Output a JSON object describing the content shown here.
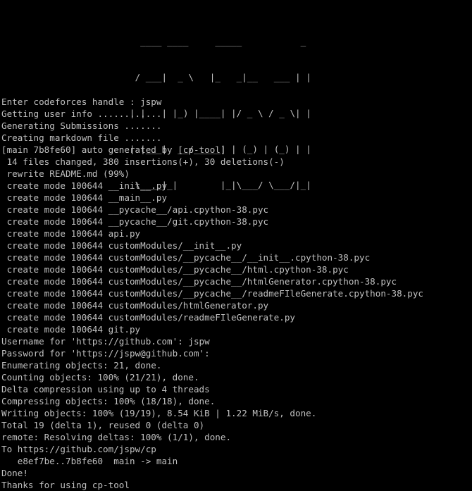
{
  "colors": {
    "background": "#000000",
    "text": "#c0c0c0"
  },
  "banner": [
    "  ____ ____     _____           _ ",
    " / ___|  _ \\   |_   _|__   ___ | |",
    "| |   | |_) |____| |/ _ \\ / _ \\| |",
    "| |___|  __/_____| | (_) | (_) | |",
    " \\____|_|        |_|\\___/ \\___/|_|"
  ],
  "lines": [
    "Enter codeforces handle : jspw",
    "Getting user info ............",
    "Generating Submissions .......",
    "Creating markdown file .......",
    "[main 7b8fe60] auto generated by [cp-tool]",
    " 14 files changed, 380 insertions(+), 30 deletions(-)",
    " rewrite README.md (99%)",
    " create mode 100644 __init__.py",
    " create mode 100644 __main__.py",
    " create mode 100644 __pycache__/api.cpython-38.pyc",
    " create mode 100644 __pycache__/git.cpython-38.pyc",
    " create mode 100644 api.py",
    " create mode 100644 customModules/__init__.py",
    " create mode 100644 customModules/__pycache__/__init__.cpython-38.pyc",
    " create mode 100644 customModules/__pycache__/html.cpython-38.pyc",
    " create mode 100644 customModules/__pycache__/htmlGenerator.cpython-38.pyc",
    " create mode 100644 customModules/__pycache__/readmeFIleGenerate.cpython-38.pyc",
    " create mode 100644 customModules/htmlGenerator.py",
    " create mode 100644 customModules/readmeFIleGenerate.py",
    " create mode 100644 git.py",
    "Username for 'https://github.com': jspw",
    "Password for 'https://jspw@github.com':",
    "Enumerating objects: 21, done.",
    "Counting objects: 100% (21/21), done.",
    "Delta compression using up to 4 threads",
    "Compressing objects: 100% (18/18), done.",
    "Writing objects: 100% (19/19), 8.54 KiB | 1.22 MiB/s, done.",
    "Total 19 (delta 1), reused 0 (delta 0)",
    "remote: Resolving deltas: 100% (1/1), done.",
    "To https://github.com/jspw/cp",
    "   e8ef7be..7b8fe60  main -> main",
    "Done!",
    "Thanks for using cp-tool"
  ]
}
